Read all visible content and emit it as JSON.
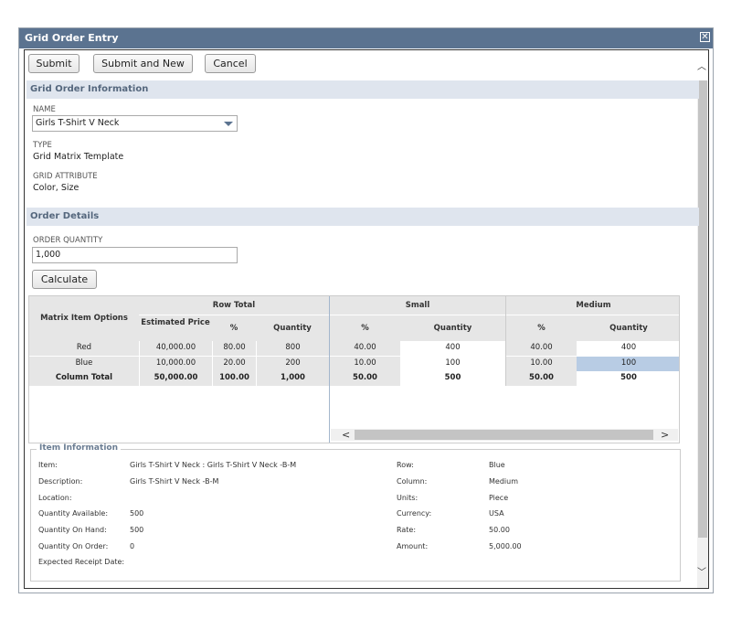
{
  "dialog": {
    "title": "Grid Order Entry"
  },
  "toolbar": {
    "submit_label": "Submit",
    "submit_new_label": "Submit and New",
    "cancel_label": "Cancel"
  },
  "grid_order_info": {
    "heading": "Grid Order Information",
    "name_label": "NAME",
    "name_value": "Girls T-Shirt V Neck",
    "type_label": "TYPE",
    "type_value": "Grid Matrix Template",
    "attr_label": "GRID ATTRIBUTE",
    "attr_value": "Color, Size"
  },
  "order_details": {
    "heading": "Order Details",
    "qty_label": "ORDER QUANTITY",
    "qty_value": "1,000",
    "calculate_label": "Calculate"
  },
  "matrix": {
    "options_header": "Matrix Item Options",
    "row_total_header": "Row Total",
    "small_header": "Small",
    "medium_header": "Medium",
    "sub": {
      "est_price": "Estimated Price",
      "pct": "%",
      "qty": "Quantity"
    },
    "rows": [
      {
        "name": "Red",
        "price": "40,000.00",
        "pct": "80.00",
        "qty": "800",
        "small_pct": "40.00",
        "small_qty": "400",
        "medium_pct": "40.00",
        "medium_qty": "400"
      },
      {
        "name": "Blue",
        "price": "10,000.00",
        "pct": "20.00",
        "qty": "200",
        "small_pct": "10.00",
        "small_qty": "100",
        "medium_pct": "10.00",
        "medium_qty": "100"
      }
    ],
    "total": {
      "name": "Column Total",
      "price": "50,000.00",
      "pct": "100.00",
      "qty": "1,000",
      "small_pct": "50.00",
      "small_qty": "500",
      "medium_pct": "50.00",
      "medium_qty": "500"
    }
  },
  "item_info": {
    "legend": "Item Information",
    "left": [
      {
        "label": "Item:",
        "value": "Girls T-Shirt V Neck : Girls T-Shirt V Neck -B-M"
      },
      {
        "label": "Description:",
        "value": "Girls T-Shirt V Neck -B-M"
      },
      {
        "label": "Location:",
        "value": ""
      },
      {
        "label": "Quantity Available:",
        "value": "500"
      },
      {
        "label": "Quantity On Hand:",
        "value": "500"
      },
      {
        "label": "Quantity On Order:",
        "value": "0"
      },
      {
        "label": "Expected Receipt Date:",
        "value": ""
      }
    ],
    "right": [
      {
        "label": "Row:",
        "value": "Blue"
      },
      {
        "label": "Column:",
        "value": "Medium"
      },
      {
        "label": "Units:",
        "value": "Piece"
      },
      {
        "label": "Currency:",
        "value": "USA"
      },
      {
        "label": "Rate:",
        "value": "50.00"
      },
      {
        "label": "Amount:",
        "value": "5,000.00"
      }
    ]
  }
}
